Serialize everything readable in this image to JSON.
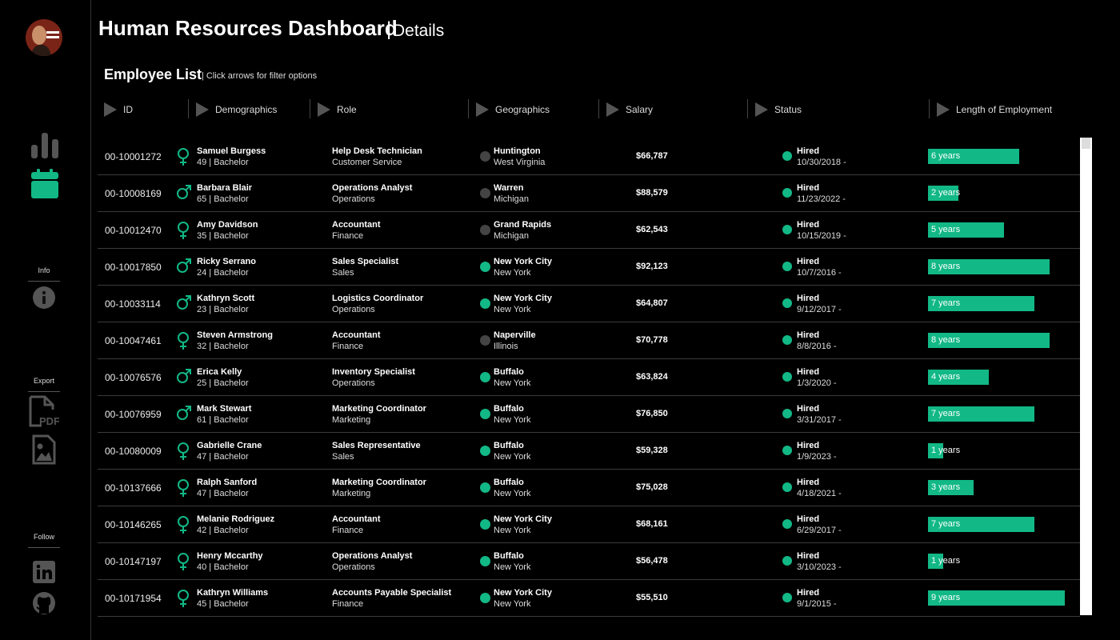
{
  "header": {
    "title": "Human Resources Dashboard",
    "separator": "|",
    "subtitle": "Details"
  },
  "list": {
    "title": "Employee List",
    "hint": "| Click arrows for filter options"
  },
  "sidebar": {
    "avatar_icon": "profile-avatar",
    "icons": [
      "bar-chart-icon",
      "calendar-icon",
      "info-icon",
      "pdf-file-icon",
      "image-file-icon",
      "linkedin-icon",
      "github-icon"
    ],
    "sections": {
      "info": "Info",
      "export": "Export",
      "follow": "Follow"
    }
  },
  "columns": [
    "ID",
    "Demographics",
    "Role",
    "Geographics",
    "Salary",
    "Status",
    "Length of Employment"
  ],
  "colors": {
    "accent": "#12b886",
    "inactive_dot": "#444444",
    "background": "#000000"
  },
  "rows": [
    {
      "id": "00-10001272",
      "gender": "female",
      "name": "Samuel Burgess",
      "demo": "49 | Bachelor",
      "role": "Help Desk Technician",
      "dept": "Customer Service",
      "city": "Huntington",
      "state": "West Virginia",
      "geo_active": false,
      "salary": "$66,787",
      "status": "Hired",
      "date": "10/30/2018 -",
      "years_label": "6 years",
      "years": 6
    },
    {
      "id": "00-10008169",
      "gender": "male",
      "name": "Barbara Blair",
      "demo": "65 | Bachelor",
      "role": "Operations Analyst",
      "dept": "Operations",
      "city": "Warren",
      "state": "Michigan",
      "geo_active": false,
      "salary": "$88,579",
      "status": "Hired",
      "date": "11/23/2022 -",
      "years_label": "2 years",
      "years": 2
    },
    {
      "id": "00-10012470",
      "gender": "female",
      "name": "Amy Davidson",
      "demo": "35 | Bachelor",
      "role": "Accountant",
      "dept": "Finance",
      "city": "Grand Rapids",
      "state": "Michigan",
      "geo_active": false,
      "salary": "$62,543",
      "status": "Hired",
      "date": "10/15/2019 -",
      "years_label": "5 years",
      "years": 5
    },
    {
      "id": "00-10017850",
      "gender": "male",
      "name": "Ricky Serrano",
      "demo": "24 | Bachelor",
      "role": "Sales Specialist",
      "dept": "Sales",
      "city": "New York City",
      "state": "New York",
      "geo_active": true,
      "salary": "$92,123",
      "status": "Hired",
      "date": "10/7/2016 -",
      "years_label": "8 years",
      "years": 8
    },
    {
      "id": "00-10033114",
      "gender": "male",
      "name": "Kathryn Scott",
      "demo": "23 | Bachelor",
      "role": "Logistics Coordinator",
      "dept": "Operations",
      "city": "New York City",
      "state": "New York",
      "geo_active": true,
      "salary": "$64,807",
      "status": "Hired",
      "date": "9/12/2017 -",
      "years_label": "7 years",
      "years": 7
    },
    {
      "id": "00-10047461",
      "gender": "female",
      "name": "Steven Armstrong",
      "demo": "32 | Bachelor",
      "role": "Accountant",
      "dept": "Finance",
      "city": "Naperville",
      "state": "Illinois",
      "geo_active": false,
      "salary": "$70,778",
      "status": "Hired",
      "date": "8/8/2016 -",
      "years_label": "8 years",
      "years": 8
    },
    {
      "id": "00-10076576",
      "gender": "male",
      "name": "Erica Kelly",
      "demo": "25 | Bachelor",
      "role": "Inventory Specialist",
      "dept": "Operations",
      "city": "Buffalo",
      "state": "New York",
      "geo_active": true,
      "salary": "$63,824",
      "status": "Hired",
      "date": "1/3/2020 -",
      "years_label": "4 years",
      "years": 4
    },
    {
      "id": "00-10076959",
      "gender": "male",
      "name": "Mark Stewart",
      "demo": "61 | Bachelor",
      "role": "Marketing Coordinator",
      "dept": "Marketing",
      "city": "Buffalo",
      "state": "New York",
      "geo_active": true,
      "salary": "$76,850",
      "status": "Hired",
      "date": "3/31/2017 -",
      "years_label": "7 years",
      "years": 7
    },
    {
      "id": "00-10080009",
      "gender": "female",
      "name": "Gabrielle Crane",
      "demo": "47 | Bachelor",
      "role": "Sales Representative",
      "dept": "Sales",
      "city": "Buffalo",
      "state": "New York",
      "geo_active": true,
      "salary": "$59,328",
      "status": "Hired",
      "date": "1/9/2023 -",
      "years_label": "1 years",
      "years": 1
    },
    {
      "id": "00-10137666",
      "gender": "female",
      "name": "Ralph Sanford",
      "demo": "47 | Bachelor",
      "role": "Marketing Coordinator",
      "dept": "Marketing",
      "city": "Buffalo",
      "state": "New York",
      "geo_active": true,
      "salary": "$75,028",
      "status": "Hired",
      "date": "4/18/2021 -",
      "years_label": "3 years",
      "years": 3
    },
    {
      "id": "00-10146265",
      "gender": "female",
      "name": "Melanie Rodriguez",
      "demo": "42 | Bachelor",
      "role": "Accountant",
      "dept": "Finance",
      "city": "New York City",
      "state": "New York",
      "geo_active": true,
      "salary": "$68,161",
      "status": "Hired",
      "date": "6/29/2017 -",
      "years_label": "7 years",
      "years": 7
    },
    {
      "id": "00-10147197",
      "gender": "female",
      "name": "Henry Mccarthy",
      "demo": "40 | Bachelor",
      "role": "Operations Analyst",
      "dept": "Operations",
      "city": "Buffalo",
      "state": "New York",
      "geo_active": true,
      "salary": "$56,478",
      "status": "Hired",
      "date": "3/10/2023 -",
      "years_label": "1 years",
      "years": 1
    },
    {
      "id": "00-10171954",
      "gender": "female",
      "name": "Kathryn Williams",
      "demo": "45 | Bachelor",
      "role": "Accounts Payable Specialist",
      "dept": "Finance",
      "city": "New York City",
      "state": "New York",
      "geo_active": true,
      "salary": "$55,510",
      "status": "Hired",
      "date": "9/1/2015 -",
      "years_label": "9 years",
      "years": 9
    }
  ]
}
